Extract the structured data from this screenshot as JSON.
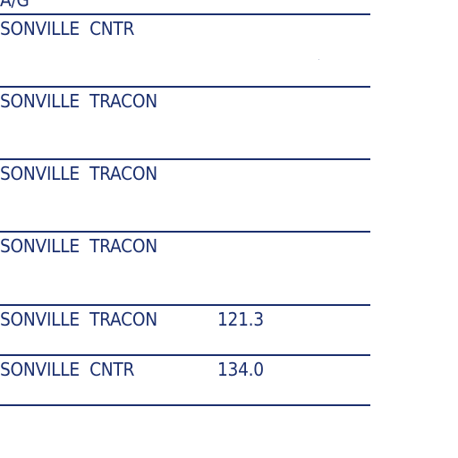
{
  "header": {
    "label": "A/G"
  },
  "entries": [
    {
      "facility": "SONVILLE  CNTR",
      "frequency": ""
    },
    {
      "facility": "SONVILLE  TRACON",
      "frequency": ""
    },
    {
      "facility": "SONVILLE  TRACON",
      "frequency": ""
    },
    {
      "facility": "SONVILLE  TRACON",
      "frequency": ""
    },
    {
      "facility": "SONVILLE  TRACON",
      "frequency": "121.3"
    },
    {
      "facility": "SONVILLE  CNTR",
      "frequency": "134.0"
    }
  ],
  "colors": {
    "ink": "#1b2f6e",
    "background": "#ffffff"
  }
}
